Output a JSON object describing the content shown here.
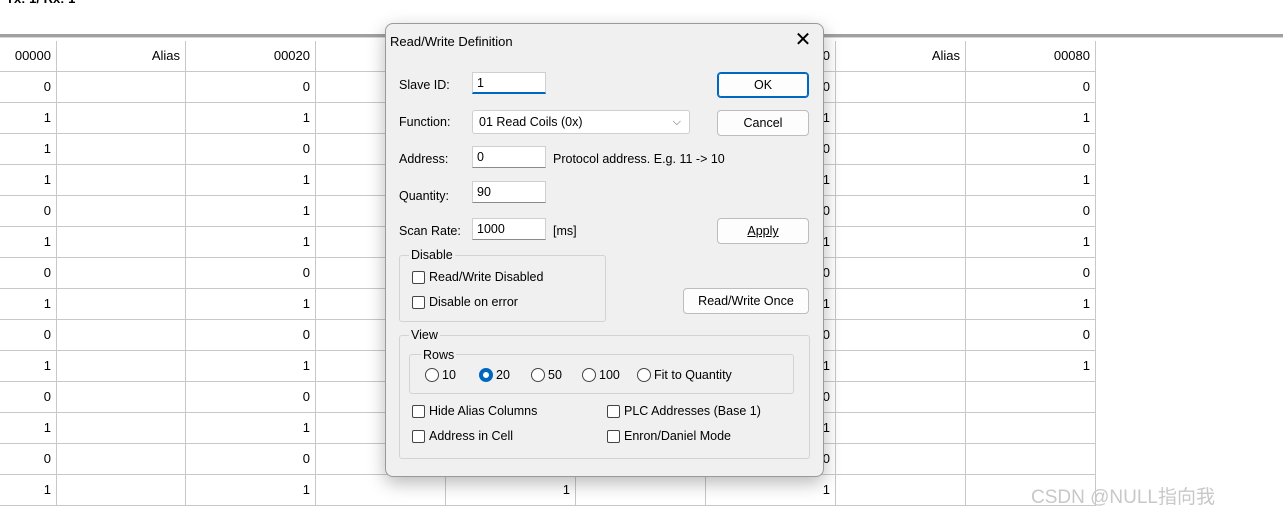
{
  "columns": [
    "00000",
    "Alias",
    "00020",
    "",
    "",
    "",
    "0",
    "Alias",
    "00080"
  ],
  "rows": [
    [
      "0",
      "",
      "0",
      "",
      "",
      "",
      "0",
      "",
      "0"
    ],
    [
      "1",
      "",
      "1",
      "",
      "",
      "",
      "1",
      "",
      "1"
    ],
    [
      "1",
      "",
      "0",
      "",
      "",
      "",
      "0",
      "",
      "0"
    ],
    [
      "1",
      "",
      "1",
      "",
      "",
      "",
      "1",
      "",
      "1"
    ],
    [
      "0",
      "",
      "1",
      "",
      "",
      "",
      "0",
      "",
      "0"
    ],
    [
      "1",
      "",
      "1",
      "",
      "",
      "",
      "1",
      "",
      "1"
    ],
    [
      "0",
      "",
      "0",
      "",
      "",
      "",
      "0",
      "",
      "0"
    ],
    [
      "1",
      "",
      "1",
      "",
      "",
      "",
      "1",
      "",
      "1"
    ],
    [
      "0",
      "",
      "0",
      "",
      "",
      "",
      "0",
      "",
      "0"
    ],
    [
      "1",
      "",
      "1",
      "",
      "",
      "",
      "1",
      "",
      "1"
    ],
    [
      "0",
      "",
      "0",
      "",
      "",
      "",
      "0",
      "",
      ""
    ],
    [
      "1",
      "",
      "1",
      "",
      "",
      "",
      "1",
      "",
      ""
    ],
    [
      "0",
      "",
      "0",
      "",
      "",
      "",
      "0",
      "",
      ""
    ],
    [
      "1",
      "",
      "1",
      "",
      "1",
      "",
      "1",
      "",
      ""
    ]
  ],
  "dialog": {
    "title": "Read/Write Definition",
    "slave_id_label": "Slave ID:",
    "slave_id": "1",
    "function_label": "Function:",
    "function": "01 Read Coils (0x)",
    "address_label": "Address:",
    "address": "0",
    "address_hint": "Protocol address. E.g. 11 -> 10",
    "quantity_label": "Quantity:",
    "quantity": "90",
    "scan_rate_label": "Scan Rate:",
    "scan_rate": "1000",
    "scan_unit": "[ms]",
    "ok": "OK",
    "cancel": "Cancel",
    "apply": "Apply",
    "rw_once": "Read/Write Once",
    "disable_group": "Disable",
    "rw_disabled": "Read/Write Disabled",
    "disable_on_error": "Disable on error",
    "view_group": "View",
    "rows_group": "Rows",
    "row_options": [
      "10",
      "20",
      "50",
      "100",
      "Fit to Quantity"
    ],
    "selected_rows": "20",
    "hide_alias": "Hide Alias Columns",
    "plc_addresses": "PLC Addresses (Base 1)",
    "address_in_cell": "Address in Cell",
    "enron_mode": "Enron/Daniel Mode"
  },
  "watermark": "CSDN @NULL指向我"
}
